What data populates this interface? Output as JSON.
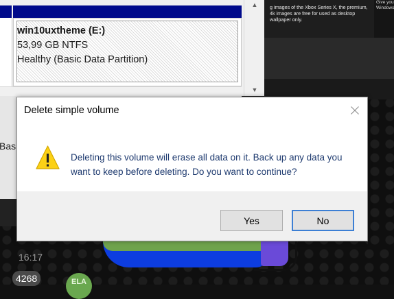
{
  "disk_volume": {
    "name": "win10uxtheme  (E:)",
    "size": "53,99 GB NTFS",
    "status": "Healthy (Basic Data Partition)"
  },
  "background": {
    "article_text": "g images of the Xbox Series X, the premium, 4k images are free for used as desktop wallpaper only.",
    "corner_text": "Give you Windows",
    "basic_fragment": "Basi"
  },
  "dialog": {
    "title": "Delete simple volume",
    "message": "Deleting this volume will erase all data on it. Back up any data you want to keep before deleting. Do you want to continue?",
    "yes_label": "Yes",
    "no_label": "No"
  },
  "chat": {
    "time": "16:17",
    "count": "4268",
    "avatar_initials": "ELA"
  },
  "colors": {
    "disk_header": "#000a8b",
    "warning_yellow": "#fcd116",
    "focus_blue": "#3c7fd4"
  },
  "icons": {
    "warning": "warning-icon",
    "close": "close-icon",
    "scroll_up": "scroll-up-arrow-icon"
  }
}
